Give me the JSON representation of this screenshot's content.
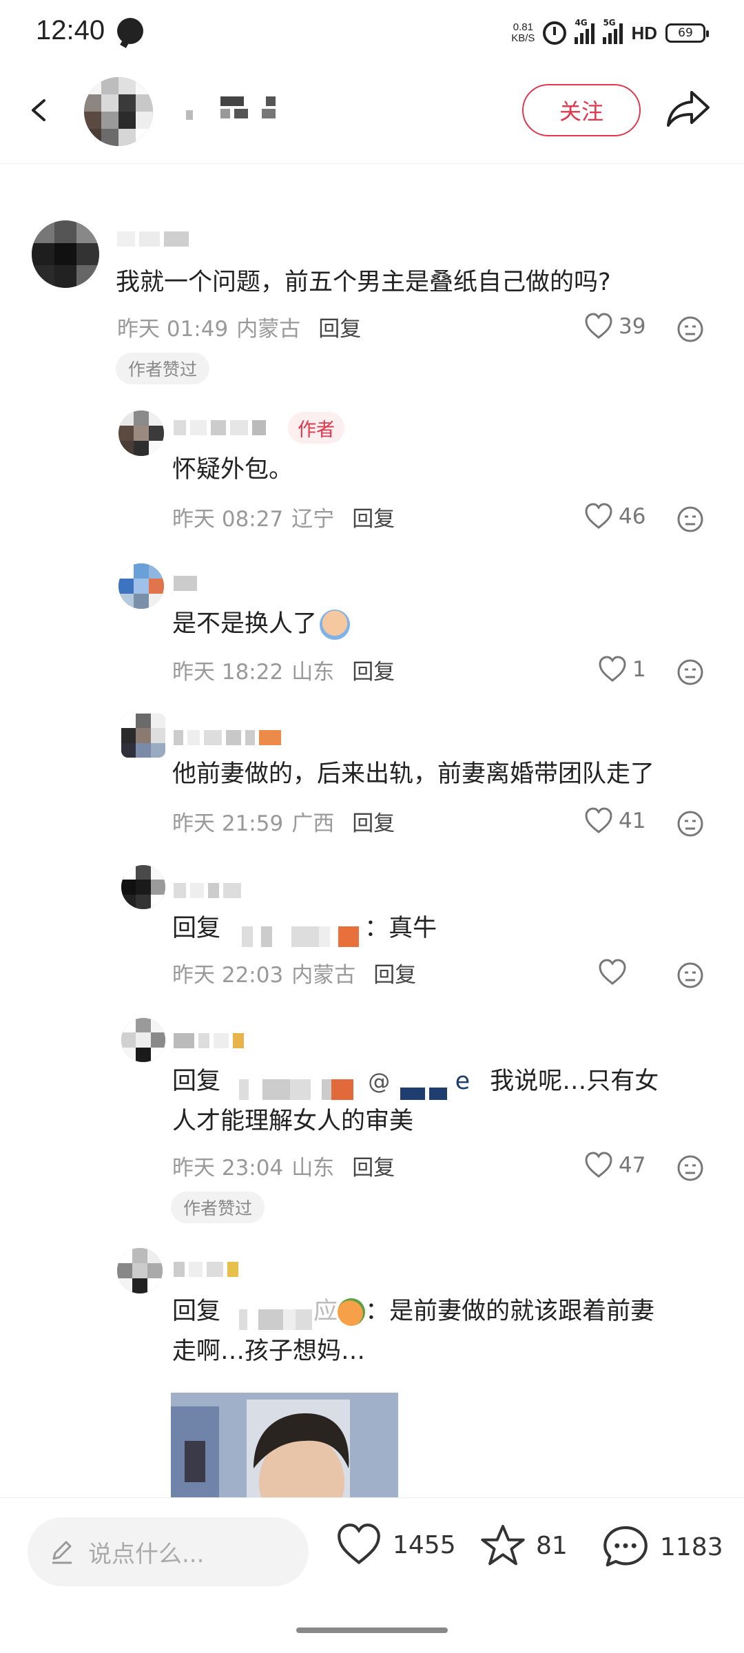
{
  "status_bar": {
    "time": "12:40",
    "net_speed_value": "0.81",
    "net_speed_unit": "KB/S",
    "signal1_tag": "4G",
    "signal2_tag": "5G",
    "hd_label": "HD",
    "battery": "69"
  },
  "header": {
    "follow_label": "关注"
  },
  "comments": [
    {
      "text": "我就一个问题，前五个男主是叠纸自己做的吗?",
      "time": "昨天 01:49",
      "location": "内蒙古",
      "reply_label": "回复",
      "likes": "39",
      "badge": "作者赞过"
    },
    {
      "author_tag": "作者",
      "text": "怀疑外包。",
      "time": "昨天 08:27",
      "location": "辽宁",
      "reply_label": "回复",
      "likes": "46"
    },
    {
      "text": "是不是换人了",
      "time": "昨天 18:22",
      "location": "山东",
      "reply_label": "回复",
      "likes": "1"
    },
    {
      "text": "他前妻做的，后来出轨，前妻离婚带团队走了",
      "time": "昨天 21:59",
      "location": "广西",
      "reply_label": "回复",
      "likes": "41"
    },
    {
      "reply_prefix": "回复",
      "text": "：真牛",
      "time": "昨天 22:03",
      "location": "内蒙古",
      "reply_label": "回复",
      "likes": ""
    },
    {
      "reply_prefix": "回复",
      "mention": "@",
      "mention_tail": "e",
      "text_line1": "我说呢…只有女",
      "text_line2": "人才能理解女人的审美",
      "time": "昨天 23:04",
      "location": "山东",
      "reply_label": "回复",
      "likes": "47",
      "badge": "作者赞过"
    },
    {
      "reply_prefix": "回复",
      "name_tail": "应",
      "text_line1": "：是前妻做的就该跟着前妻",
      "text_line2": "走啊…孩子想妈…"
    }
  ],
  "bottom_bar": {
    "input_placeholder": "说点什么...",
    "likes": "1455",
    "stars": "81",
    "comments": "1183"
  },
  "colors": {
    "accent": "#e0374d",
    "meta_gray": "#999999",
    "badge_bg": "#f2f2f2"
  }
}
